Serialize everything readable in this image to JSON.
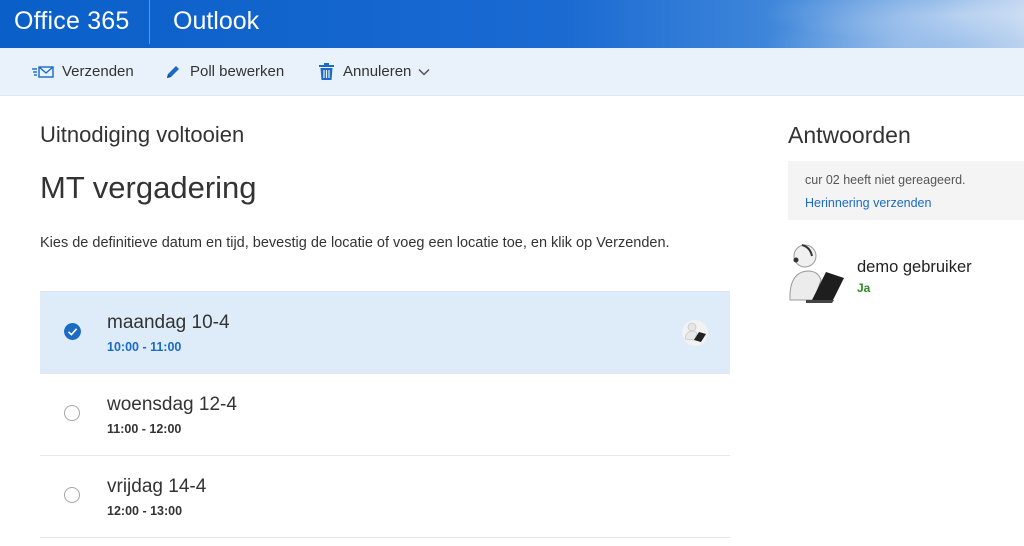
{
  "header": {
    "brand": "Office 365",
    "app_name": "Outlook"
  },
  "toolbar": {
    "send_label": "Verzenden",
    "edit_label": "Poll bewerken",
    "cancel_label": "Annuleren"
  },
  "main": {
    "subtitle": "Uitnodiging voltooien",
    "title": "MT vergadering",
    "description": "Kies de definitieve datum en tijd, bevestig de locatie of voeg een locatie toe, en klik op Verzenden.",
    "options": [
      {
        "day": "maandag 10-4",
        "time": "10:00 - 11:00",
        "selected": true
      },
      {
        "day": "woensdag 12-4",
        "time": "11:00 - 12:00",
        "selected": false
      },
      {
        "day": "vrijdag 14-4",
        "time": "12:00 - 13:00",
        "selected": false
      }
    ]
  },
  "sidebar": {
    "title": "Antwoorden",
    "notice_text": "cur 02 heeft niet gereageerd.",
    "notice_link": "Herinnering verzenden",
    "responders": [
      {
        "name": "demo gebruiker",
        "status": "Ja"
      }
    ]
  },
  "colors": {
    "brand_blue": "#0a5fc8",
    "accent_blue": "#1a6ac6",
    "selected_bg": "#deecf9",
    "yes_green": "#2e8b24"
  },
  "icons": {
    "send": "send-mail-icon",
    "edit": "pencil-icon",
    "cancel": "trash-icon",
    "dropdown": "chevron-down-icon",
    "check": "checkmark-circle-icon",
    "radio": "radio-empty-icon",
    "avatar": "person-laptop-avatar"
  }
}
